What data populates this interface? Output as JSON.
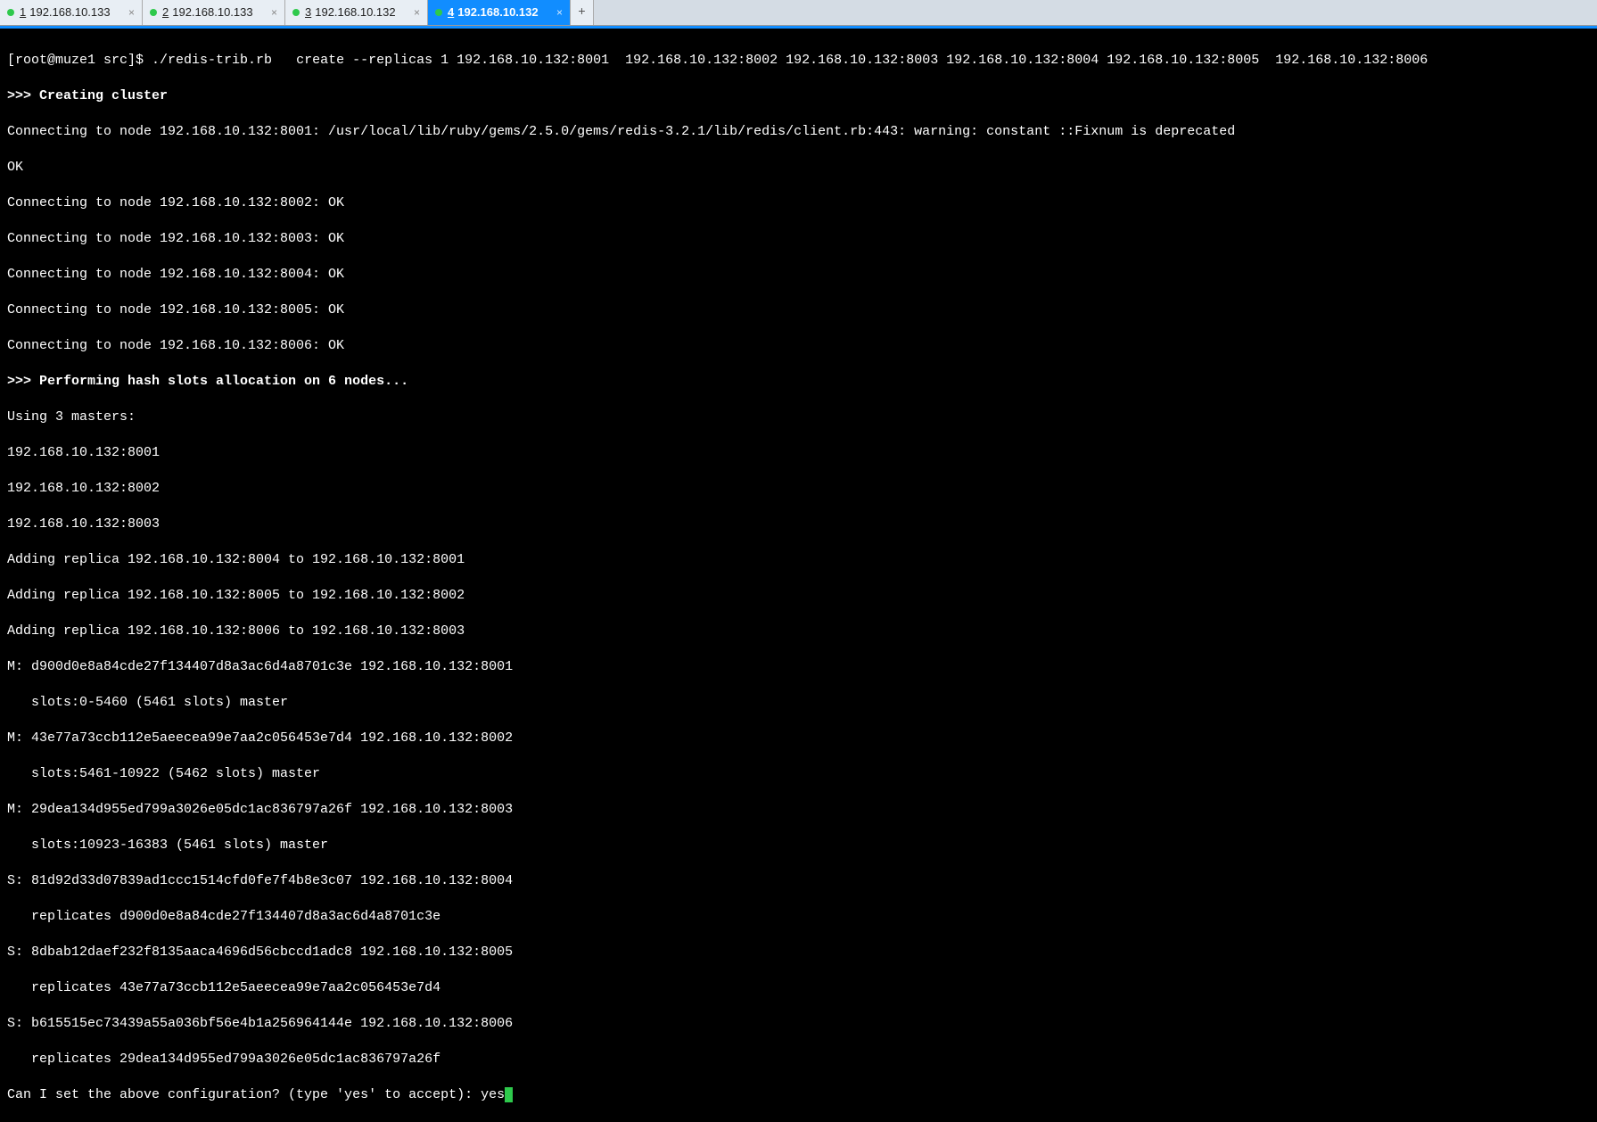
{
  "tabs": [
    {
      "num": "1",
      "title": "192.168.10.133"
    },
    {
      "num": "2",
      "title": "192.168.10.133"
    },
    {
      "num": "3",
      "title": "192.168.10.132"
    },
    {
      "num": "4",
      "title": "192.168.10.132"
    }
  ],
  "activeTab": 3,
  "newTabGlyph": "+",
  "closeGlyph": "×",
  "prompt": "[root@muze1 src]$ ",
  "cmd_part1": "./redis-trib.rb",
  "cmd_part2": "create --replicas 1 192.168.10.132:8001  192.168.10.132:8002 192.168.10.132:8003 192.168.10.132:8004 192.168.10.132:8005  192.168.10.132:8006",
  "lines": {
    "b1": ">>> Creating cluster",
    "l2": "Connecting to node 192.168.10.132:8001: /usr/local/lib/ruby/gems/2.5.0/gems/redis-3.2.1/lib/redis/client.rb:443: warning: constant ::Fixnum is deprecated",
    "l3": "OK",
    "l4": "Connecting to node 192.168.10.132:8002: OK",
    "l5": "Connecting to node 192.168.10.132:8003: OK",
    "l6": "Connecting to node 192.168.10.132:8004: OK",
    "l7": "Connecting to node 192.168.10.132:8005: OK",
    "l8": "Connecting to node 192.168.10.132:8006: OK",
    "b2": ">>> Performing hash slots allocation on 6 nodes...",
    "l9": "Using 3 masters:",
    "l10": "192.168.10.132:8001",
    "l11": "192.168.10.132:8002",
    "l12": "192.168.10.132:8003",
    "l13": "Adding replica 192.168.10.132:8004 to 192.168.10.132:8001",
    "l14": "Adding replica 192.168.10.132:8005 to 192.168.10.132:8002",
    "l15": "Adding replica 192.168.10.132:8006 to 192.168.10.132:8003",
    "l16": "M: d900d0e8a84cde27f134407d8a3ac6d4a8701c3e 192.168.10.132:8001",
    "l17": "   slots:0-5460 (5461 slots) master",
    "l18": "M: 43e77a73ccb112e5aeecea99e7aa2c056453e7d4 192.168.10.132:8002",
    "l19": "   slots:5461-10922 (5462 slots) master",
    "l20": "M: 29dea134d955ed799a3026e05dc1ac836797a26f 192.168.10.132:8003",
    "l21": "   slots:10923-16383 (5461 slots) master",
    "l22": "S: 81d92d33d07839ad1ccc1514cfd0fe7f4b8e3c07 192.168.10.132:8004",
    "l23": "   replicates d900d0e8a84cde27f134407d8a3ac6d4a8701c3e",
    "l24": "S: 8dbab12daef232f8135aaca4696d56cbccd1adc8 192.168.10.132:8005",
    "l25": "   replicates 43e77a73ccb112e5aeecea99e7aa2c056453e7d4",
    "l26": "S: b615515ec73439a55a036bf56e4b1a256964144e 192.168.10.132:8006",
    "l27": "   replicates 29dea134d955ed799a3026e05dc1ac836797a26f",
    "l28_prompt": "Can I set the above configuration? (type 'yes' to accept): ",
    "l28_input": "yes"
  }
}
